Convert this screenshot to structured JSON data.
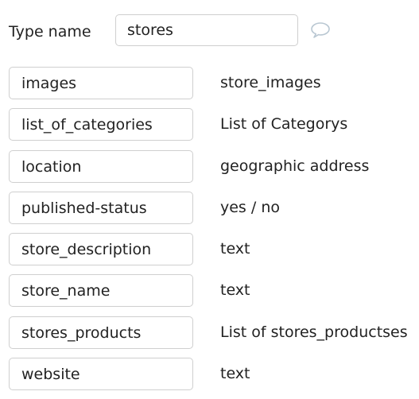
{
  "type_editor": {
    "label": "Type name",
    "value": "stores",
    "comment_icon": "speech-bubble-icon"
  },
  "fields": [
    {
      "name": "images",
      "type": "store_images"
    },
    {
      "name": "list_of_categories",
      "type": "List of Categorys"
    },
    {
      "name": "location",
      "type": "geographic address"
    },
    {
      "name": "published-status",
      "type": "yes / no"
    },
    {
      "name": "store_description",
      "type": "text"
    },
    {
      "name": "store_name",
      "type": "text"
    },
    {
      "name": "stores_products",
      "type": "List of stores_productses"
    },
    {
      "name": "website",
      "type": "text"
    }
  ],
  "colors": {
    "border": "#cfcfcf",
    "text": "#222222",
    "icon": "#b9c7d2"
  }
}
